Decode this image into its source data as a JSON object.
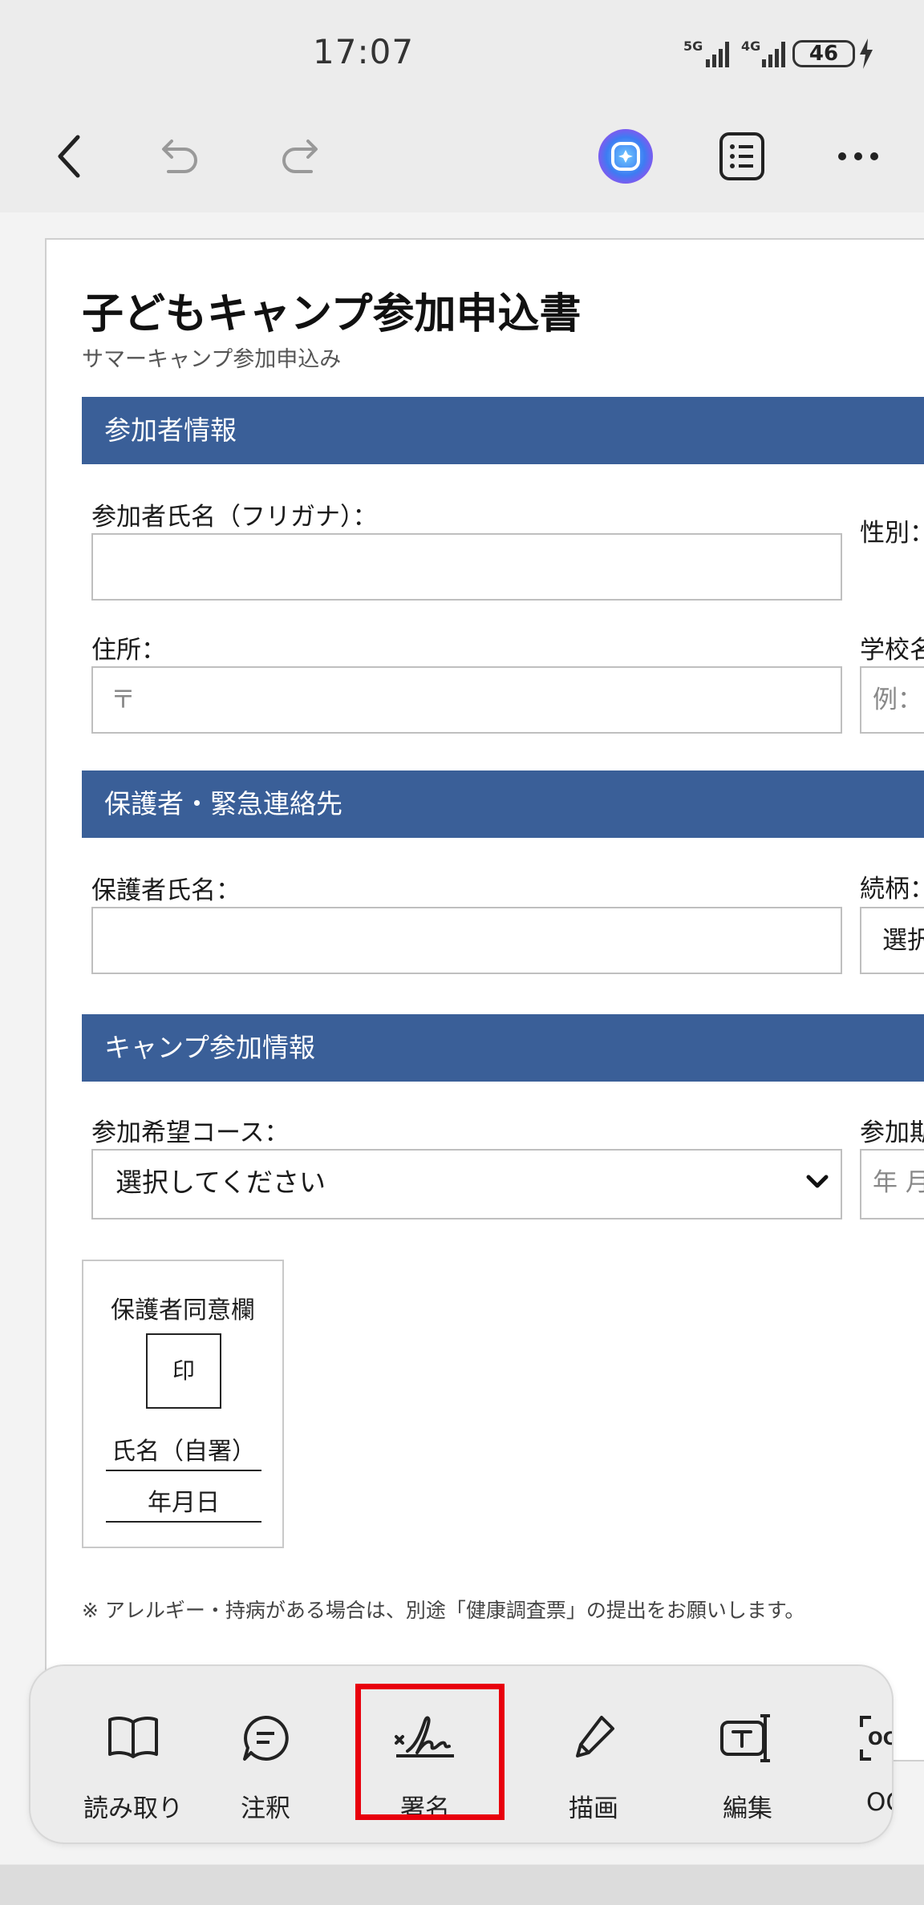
{
  "status_bar": {
    "time": "17:07",
    "network_1": "5G",
    "network_2": "4G",
    "battery": "46"
  },
  "toolbar": {
    "icons": [
      "back-icon",
      "undo-icon",
      "redo-icon",
      "ai-assistant-icon",
      "list-icon",
      "more-icon"
    ]
  },
  "document": {
    "title": "子どもキャンプ参加申込書",
    "subtitle": "サマーキャンプ参加申込み",
    "section_participant": "参加者情報",
    "label_name_kana": "参加者氏名（フリガナ）：",
    "label_gender": "性別：",
    "label_address": "住所：",
    "address_placeholder": "〒",
    "label_school": "学校名",
    "school_placeholder": "例：",
    "section_guardian": "保護者・緊急連絡先",
    "label_guardian_name": "保護者氏名：",
    "label_relation": "続柄：",
    "relation_select": "選択",
    "section_camp": "キャンプ参加情報",
    "label_course": "参加希望コース：",
    "course_select": "選択してください",
    "label_period": "参加期",
    "period_placeholder": "年 月",
    "consent_title": "保護者同意欄",
    "stamp": "印",
    "signature_line": "氏名（自署）",
    "date_line": "年月日",
    "note": "※ アレルギー・持病がある場合は、別途「健康調査票」の提出をお願いします。"
  },
  "action_bar": {
    "items": [
      {
        "label": "読み取り",
        "icon": "book-icon"
      },
      {
        "label": "注釈",
        "icon": "comment-icon"
      },
      {
        "label": "署名",
        "icon": "signature-icon"
      },
      {
        "label": "描画",
        "icon": "pen-icon"
      },
      {
        "label": "編集",
        "icon": "text-edit-icon"
      },
      {
        "label": "OC",
        "icon": "ocr-icon"
      }
    ],
    "highlight_color": "#e8000d"
  },
  "colors": {
    "section_header": "#3a5f98",
    "page_background": "#ffffff"
  }
}
